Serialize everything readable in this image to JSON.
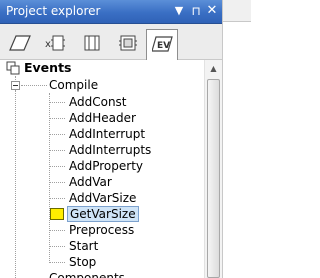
{
  "panel": {
    "title": "Project explorer",
    "buttons": {
      "dropdown": "▼",
      "pin": "⊓",
      "close": "✕"
    }
  },
  "toolbar": {
    "tools": [
      {
        "icon": "parallelogram-icon"
      },
      {
        "icon": "x-component-icon"
      },
      {
        "icon": "component-icon"
      },
      {
        "icon": "component-box-icon"
      },
      {
        "icon": "events-icon",
        "selected": true,
        "text": "EV"
      }
    ]
  },
  "tree": {
    "root": {
      "label": "Events",
      "icon": "events-tree-icon"
    },
    "groups": [
      {
        "label": "Compile",
        "expanded": true,
        "items": [
          "AddConst",
          "AddHeader",
          "AddInterrupt",
          "AddInterrupts",
          "AddProperty",
          "AddVar",
          "AddVarSize",
          "GetVarSize",
          "Preprocess",
          "Start",
          "Stop"
        ],
        "selected_item": "GetVarSize"
      },
      {
        "label": "Components",
        "expanded": false
      }
    ]
  },
  "colors": {
    "titlebar": "#3a6fc4",
    "selection": "#cfe4f7",
    "marker": "#ffee00"
  }
}
